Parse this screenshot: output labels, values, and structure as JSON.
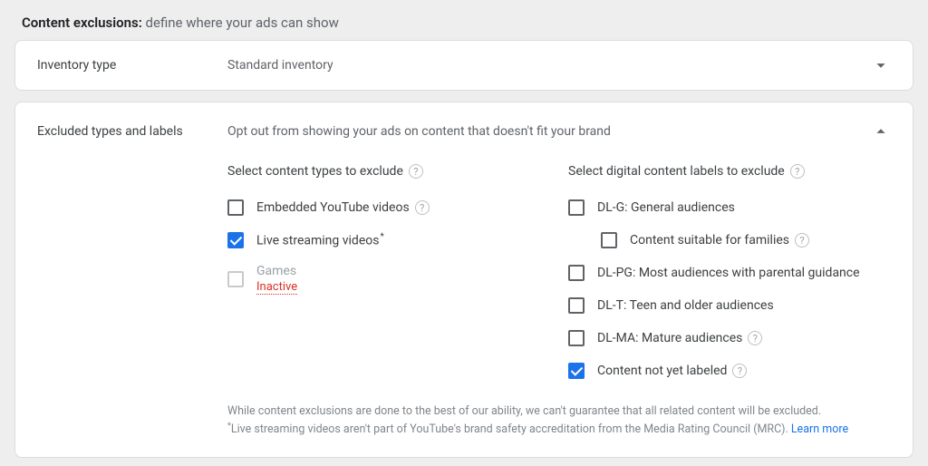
{
  "section": {
    "title_bold": "Content exclusions:",
    "title_desc": "define where your ads can show"
  },
  "inventory": {
    "label": "Inventory type",
    "value": "Standard inventory"
  },
  "excluded": {
    "label": "Excluded types and labels",
    "subtitle": "Opt out from showing your ads on content that doesn't fit your brand",
    "left_header": "Select content types to exclude",
    "right_header": "Select digital content labels to exclude",
    "content_types": [
      {
        "label": "Embedded YouTube videos",
        "checked": false,
        "help": true
      },
      {
        "label": "Live streaming videos",
        "checked": true,
        "asterisk": true,
        "highlight": true
      },
      {
        "label": "Games",
        "sublabel": "Inactive",
        "disabled": true
      }
    ],
    "labels": [
      {
        "label": "DL-G: General audiences",
        "checked": false
      },
      {
        "label": "Content suitable for families",
        "checked": false,
        "help": true,
        "indented": true
      },
      {
        "label": "DL-PG: Most audiences with parental guidance",
        "checked": false
      },
      {
        "label": "DL-T: Teen and older audiences",
        "checked": false
      },
      {
        "label": "DL-MA: Mature audiences",
        "checked": false,
        "help": true
      },
      {
        "label": "Content not yet labeled",
        "checked": true,
        "help": true
      }
    ],
    "footnote_line1": "While content exclusions are done to the best of our ability, we can't guarantee that all related content will be excluded.",
    "footnote_line2": "Live streaming videos aren't part of YouTube's brand safety accreditation from the Media Rating Council (MRC).",
    "learn_more": "Learn more"
  }
}
